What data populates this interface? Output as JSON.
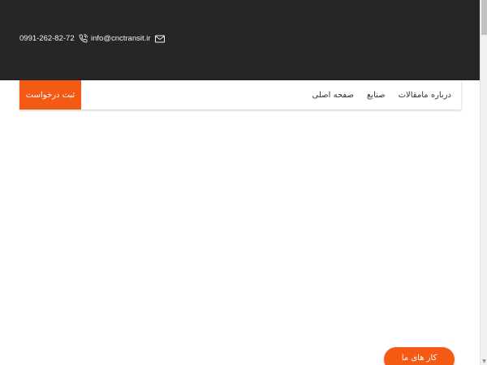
{
  "header": {
    "phone": "0991-262-82-72",
    "phone_icon": "phone-icon",
    "email": "info@cnctransit.ir",
    "email_icon": "mail-icon",
    "background": "#262626"
  },
  "nav": {
    "items": [
      {
        "label": "صفحه اصلی"
      },
      {
        "label": "صنایع"
      },
      {
        "label": "مقالات"
      },
      {
        "label": "درباره ما"
      }
    ],
    "cta_label": "ثبت درخواست"
  },
  "floating": {
    "label": "کار های ما"
  },
  "colors": {
    "accent": "#f55a14",
    "topbar": "#262626"
  }
}
